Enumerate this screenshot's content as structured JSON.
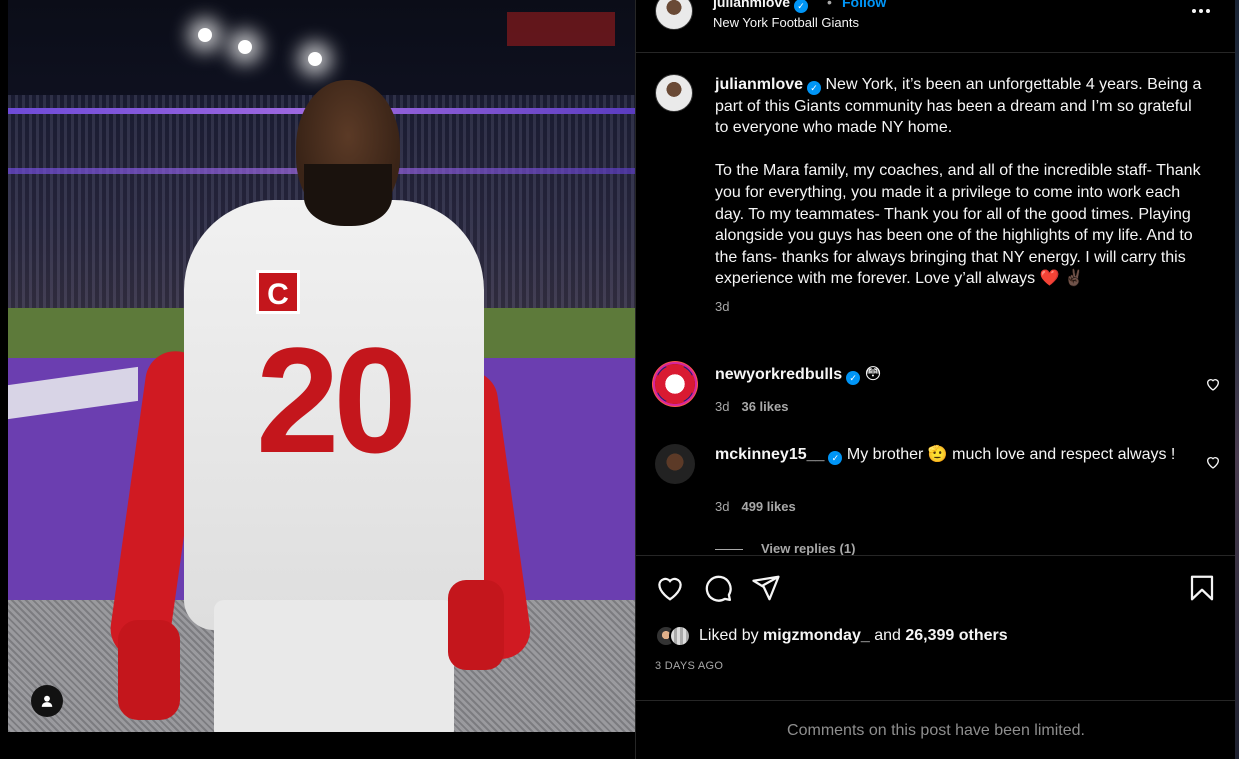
{
  "photo": {
    "jersey_number": "20",
    "captain_patch": "C"
  },
  "header": {
    "username": "julianmlove",
    "verified_mark": "✓",
    "separator": "•",
    "follow_label": "Follow",
    "subtitle": "New York Football Giants"
  },
  "caption": {
    "username": "julianmlove",
    "text": "New York, it’s been an unforgettable 4 years. Being a part of this Giants community has been a dream and I’m so grateful to everyone who made NY home.\n\nTo the Mara family, my coaches, and all of the incredible staff- Thank you for everything, you made it a privilege to come into work each day. To my teammates- Thank you for all of the good times. Playing alongside you guys has been one of the highlights of my life. And to the fans- thanks for always bringing that NY energy. I will carry this experience with me forever. Love y’all always",
    "emoji": "❤️ ✌🏿",
    "time": "3d"
  },
  "comments": [
    {
      "username": "newyorkredbulls",
      "text": "😳",
      "time": "3d",
      "likes": "36 likes"
    },
    {
      "username": "mckinney15__",
      "text": "My brother 🫡 much love and respect always !",
      "time": "3d",
      "likes": "499 likes"
    }
  ],
  "view_replies": "View replies (1)",
  "likes": {
    "prefix": "Liked by",
    "user": "migzmonday_",
    "connector": "and",
    "others": "26,399 others"
  },
  "time_ago": "3 DAYS AGO",
  "limited_notice": "Comments on this post have been limited.",
  "colors": {
    "accent": "#0095f6",
    "background": "#000000",
    "secondary_text": "#a8a8a8",
    "giants_red": "#c4161c"
  }
}
